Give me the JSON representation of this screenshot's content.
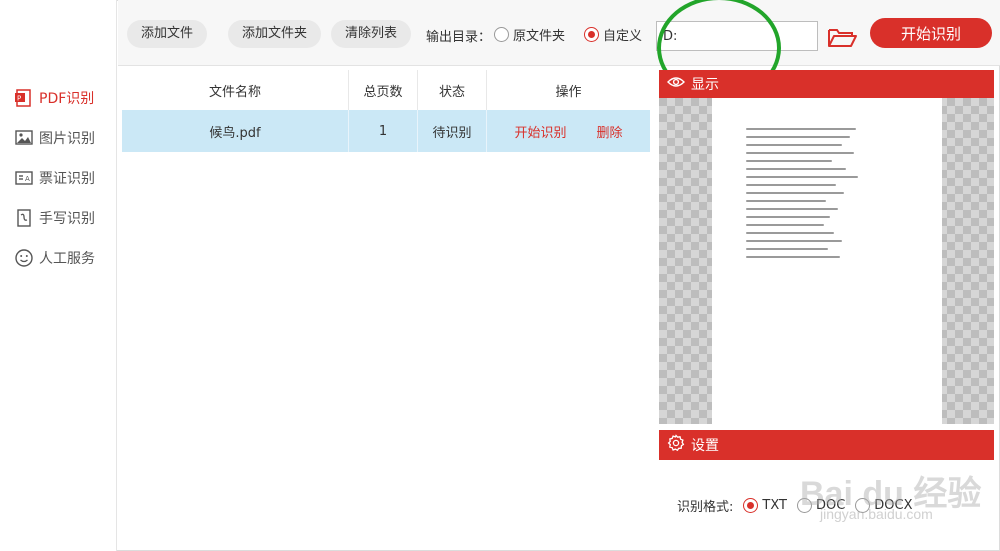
{
  "sidebar": {
    "items": [
      {
        "label": "PDF识别",
        "icon": "pdf-icon",
        "active": true
      },
      {
        "label": "图片识别",
        "icon": "image-icon",
        "active": false
      },
      {
        "label": "票证识别",
        "icon": "ticket-icon",
        "active": false
      },
      {
        "label": "手写识别",
        "icon": "handwriting-icon",
        "active": false
      },
      {
        "label": "人工服务",
        "icon": "smiley-icon",
        "active": false
      }
    ]
  },
  "toolbar": {
    "add_file": "添加文件",
    "add_folder": "添加文件夹",
    "clear_list": "清除列表",
    "output_label": "输出目录：",
    "option_original": "原文件夹",
    "option_custom": "自定义",
    "selected_option": "自定义",
    "path_value": "D:",
    "start_label": "开始识别",
    "accent_color": "#d9302a"
  },
  "table": {
    "headers": [
      "文件名称",
      "总页数",
      "状态",
      "操作"
    ],
    "rows": [
      {
        "name": "候鸟.pdf",
        "pages": "1",
        "status": "待识别",
        "action_start": "开始识别",
        "action_delete": "删除"
      }
    ]
  },
  "preview": {
    "title": "显示"
  },
  "settings": {
    "title": "设置",
    "format_label": "识别格式:",
    "formats": [
      "TXT",
      "DOC",
      "DOCX"
    ],
    "selected_format": "TXT"
  },
  "watermark": {
    "text": "Bai du 经验",
    "sub": "jingyan.baidu.com"
  }
}
